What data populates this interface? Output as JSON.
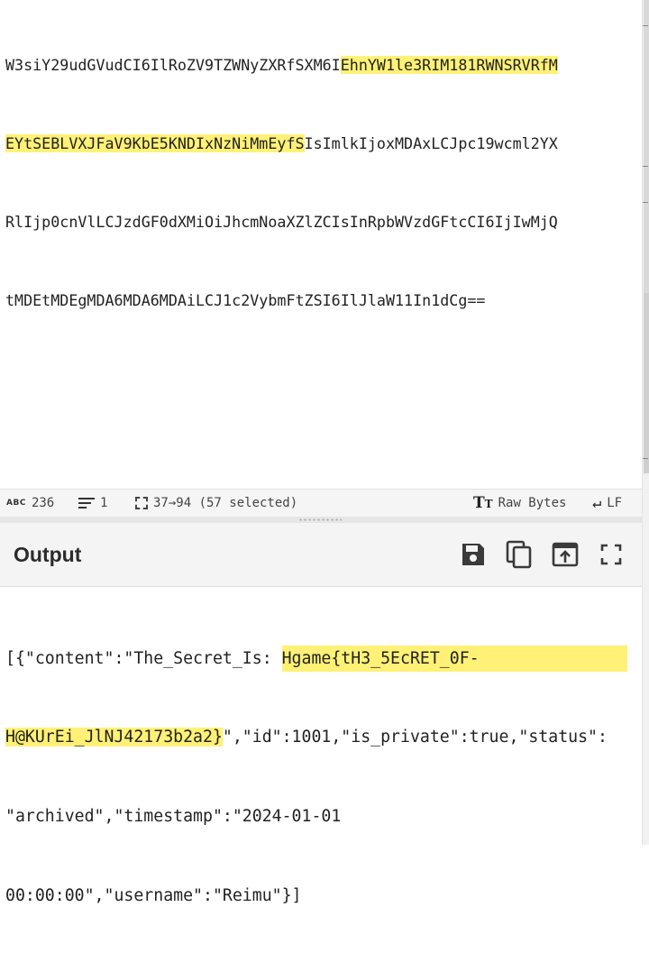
{
  "input": {
    "line1": {
      "before": "W3siY29udGVudCI6IlRoZV9TZWNyZXRfSXM6I",
      "highlight": "EhnYW1le3RIM181RWNSRVRfM"
    },
    "line2": {
      "highlight": "EYtSEBLVXJFaV9KbE5KNDIxNzNiMmEyfS",
      "after": "IsImlkIjoxMDAxLCJpc19wcml2YX"
    },
    "line3": "RlIjp0cnVlLCJzdGF0dXMiOiJhcmNoaXZlZCIsInRpbWVzdGFtcCI6IjIwMjQ",
    "line4": "tMDEtMDEgMDA6MDA6MDAiLCJ1c2VybmFtZSI6IlJlaW11In1dCg=="
  },
  "status_bar": {
    "abc_icon": "ABC",
    "char_count": "236",
    "line_count": "1",
    "selection": "37→94 (57 selected)",
    "encoding_icon": "TT",
    "encoding_label": "Raw Bytes",
    "eol_label": "LF"
  },
  "output": {
    "title": "Output",
    "buttons": [
      "save-icon",
      "copy-icon",
      "replace-input-icon",
      "maximise-icon"
    ],
    "line1": {
      "before": "[{\"content\":\"The_Secret_Is: ",
      "highlight": "Hgame{tH3_5EcRET_0F-"
    },
    "line2": {
      "highlight": "H@KUrEi_JlNJ42173b2a2}",
      "after": "\",\"id\":1001,\"is_private\":true,\"status\":"
    },
    "line3": "\"archived\",\"timestamp\":\"2024-01-01",
    "line4": "00:00:00\",\"username\":\"Reimu\"}]"
  },
  "colors": {
    "highlight": "#fff176",
    "status_bg": "#f5f5f5",
    "header_bg": "#f4f4f4"
  }
}
